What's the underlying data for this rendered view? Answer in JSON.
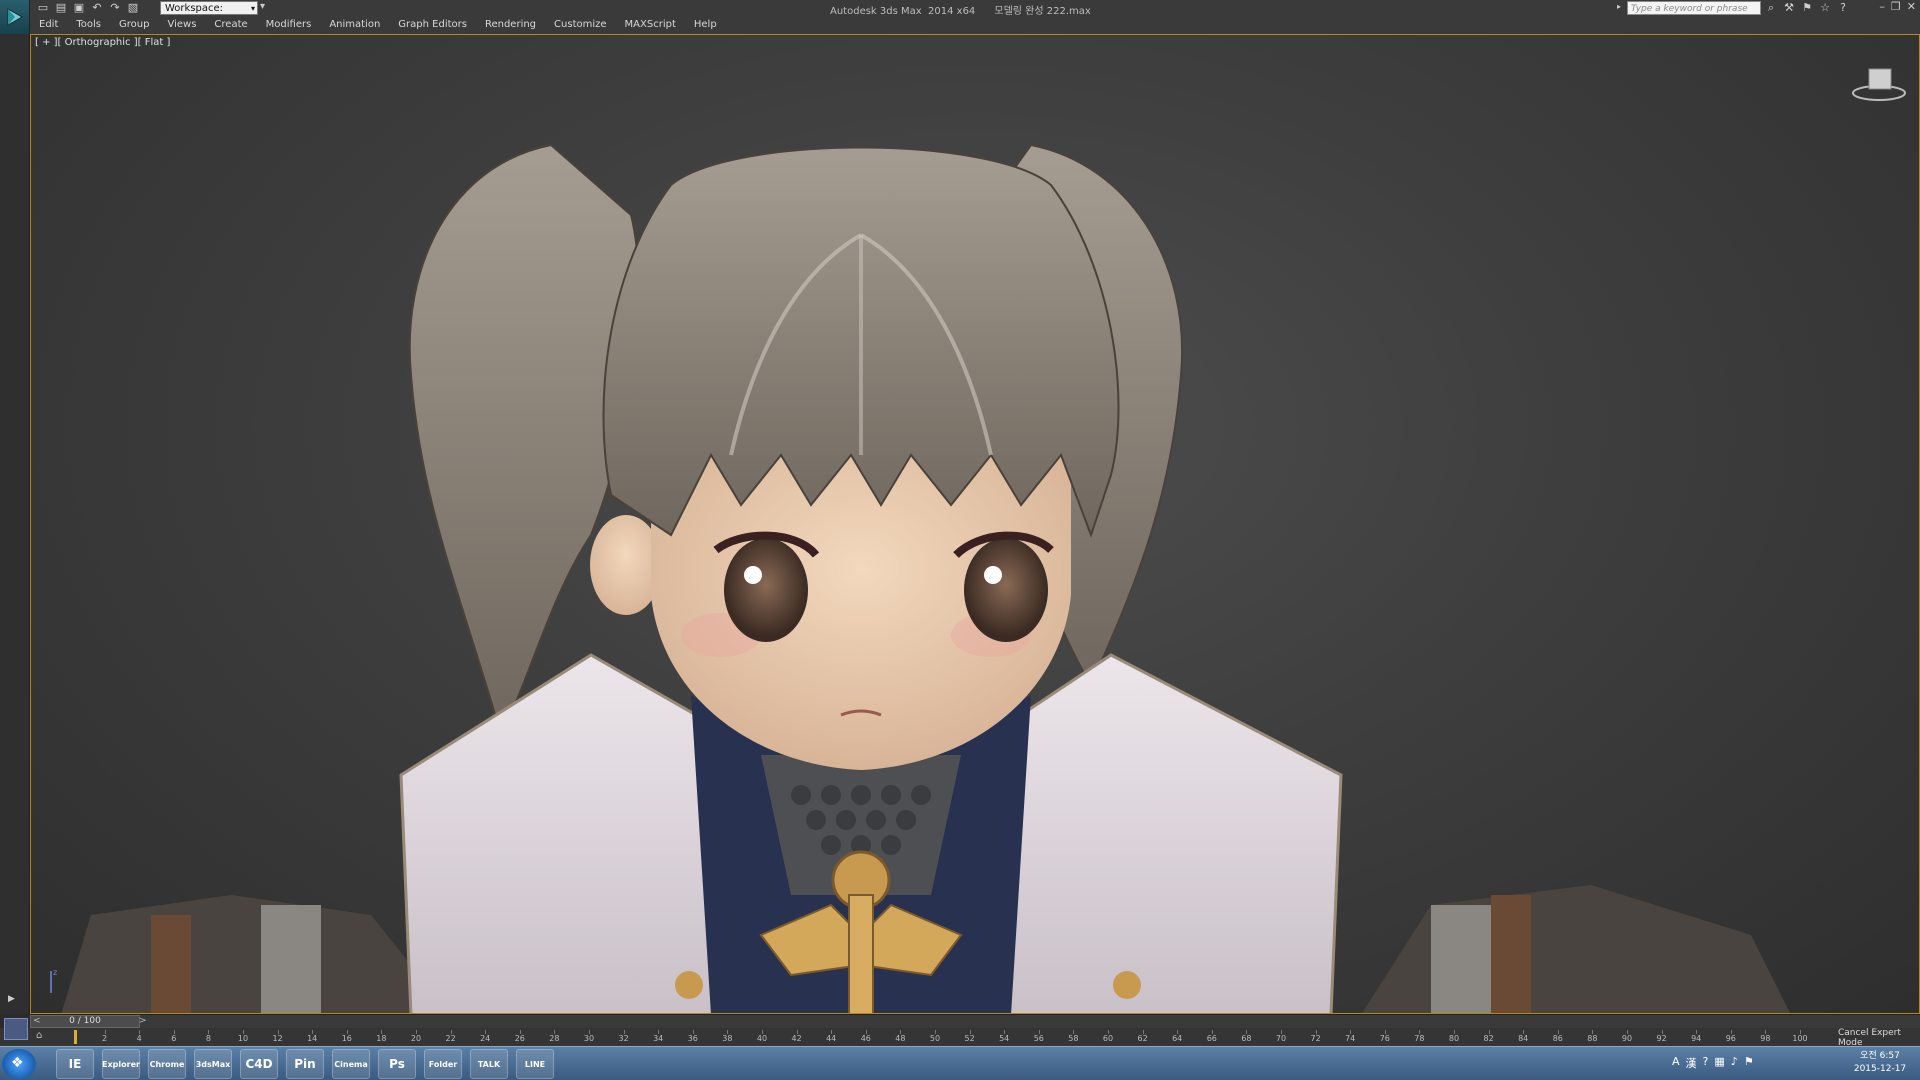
{
  "window": {
    "title": "Autodesk 3ds Max  2014 x64      모델링 완성 222.max",
    "workspace": "Workspace: Default",
    "search_placeholder": "Type a keyword or phrase"
  },
  "menu": [
    "Edit",
    "Tools",
    "Group",
    "Views",
    "Create",
    "Modifiers",
    "Animation",
    "Graph Editors",
    "Rendering",
    "Customize",
    "MAXScript",
    "Help"
  ],
  "viewport": {
    "label": "[ + ][ Orthographic ][ Flat ]",
    "axis_label": "z"
  },
  "timeline": {
    "frame_display": "0 / 100",
    "ticks": [
      "2",
      "4",
      "6",
      "8",
      "10",
      "12",
      "14",
      "16",
      "18",
      "20",
      "22",
      "24",
      "26",
      "28",
      "30",
      "32",
      "34",
      "36",
      "38",
      "40",
      "42",
      "44",
      "46",
      "48",
      "50",
      "52",
      "54",
      "56",
      "58",
      "60",
      "62",
      "64",
      "66",
      "68",
      "70",
      "72",
      "74",
      "76",
      "78",
      "80",
      "82",
      "84",
      "86",
      "88",
      "90",
      "92",
      "94",
      "96",
      "98",
      "100"
    ],
    "status": "Cancel Expert Mode"
  },
  "taskbar": {
    "apps": [
      "IE",
      "Explorer",
      "Chrome",
      "3dsMax",
      "C4D",
      "Pin",
      "Cinema",
      "Ps",
      "Folder",
      "TALK",
      "LINE"
    ],
    "clock_time": "오전 6:57",
    "clock_date": "2015-12-17"
  },
  "colors": {
    "accent_border": "#b28a1c",
    "taskbar": "#3b5b80"
  }
}
